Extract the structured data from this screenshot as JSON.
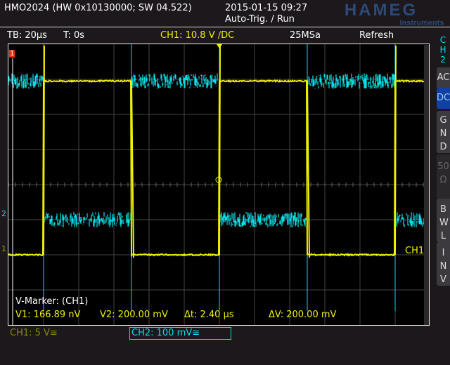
{
  "header": {
    "model": "HMO2024 (HW 0x10130000; SW 04.522)",
    "datetime": "2015-01-15 09:27",
    "trigger_state": "Auto-Trig. / Run",
    "brand": "HAMEG",
    "brand_sub": "Instruments"
  },
  "status": {
    "timebase": "TB: 20µs",
    "trigger_time": "T: 0s",
    "ch1_trigger": "CH1: 10.8 V ∕DC",
    "sample_rate": "25MSa",
    "mode": "Refresh"
  },
  "side_menu": {
    "channel": "CH2",
    "items": [
      "AC",
      "DC",
      "GND",
      "50Ω",
      "BWL",
      "INV"
    ],
    "active": "DC"
  },
  "markers": {
    "title": "V-Marker: (CH1)",
    "v1": "V1: 166.89 nV",
    "v2": "V2: 200.00 mV",
    "dt": "Δt: 2.40 µs",
    "dv": "ΔV: 200.00 mV"
  },
  "channels": {
    "ch1_scale": "CH1: 5 V≅",
    "ch2_scale": "CH2: 100 mV≅",
    "ch1_label": "CH1",
    "ch1_marker": "1",
    "ch2_marker": "2",
    "trig_marker": "1"
  },
  "colors": {
    "ch1": "#f0f000",
    "ch2": "#00e0e8",
    "grid": "#444444"
  },
  "waveform": {
    "period_div": 5,
    "ch1_high_div": 2.95,
    "ch1_low_div": -2.0,
    "ch2_high_div": 2.95,
    "ch2_low_div": -1.0,
    "rise_div": [
      1,
      6,
      11
    ],
    "fall_div": [
      3.5,
      8.5
    ]
  }
}
